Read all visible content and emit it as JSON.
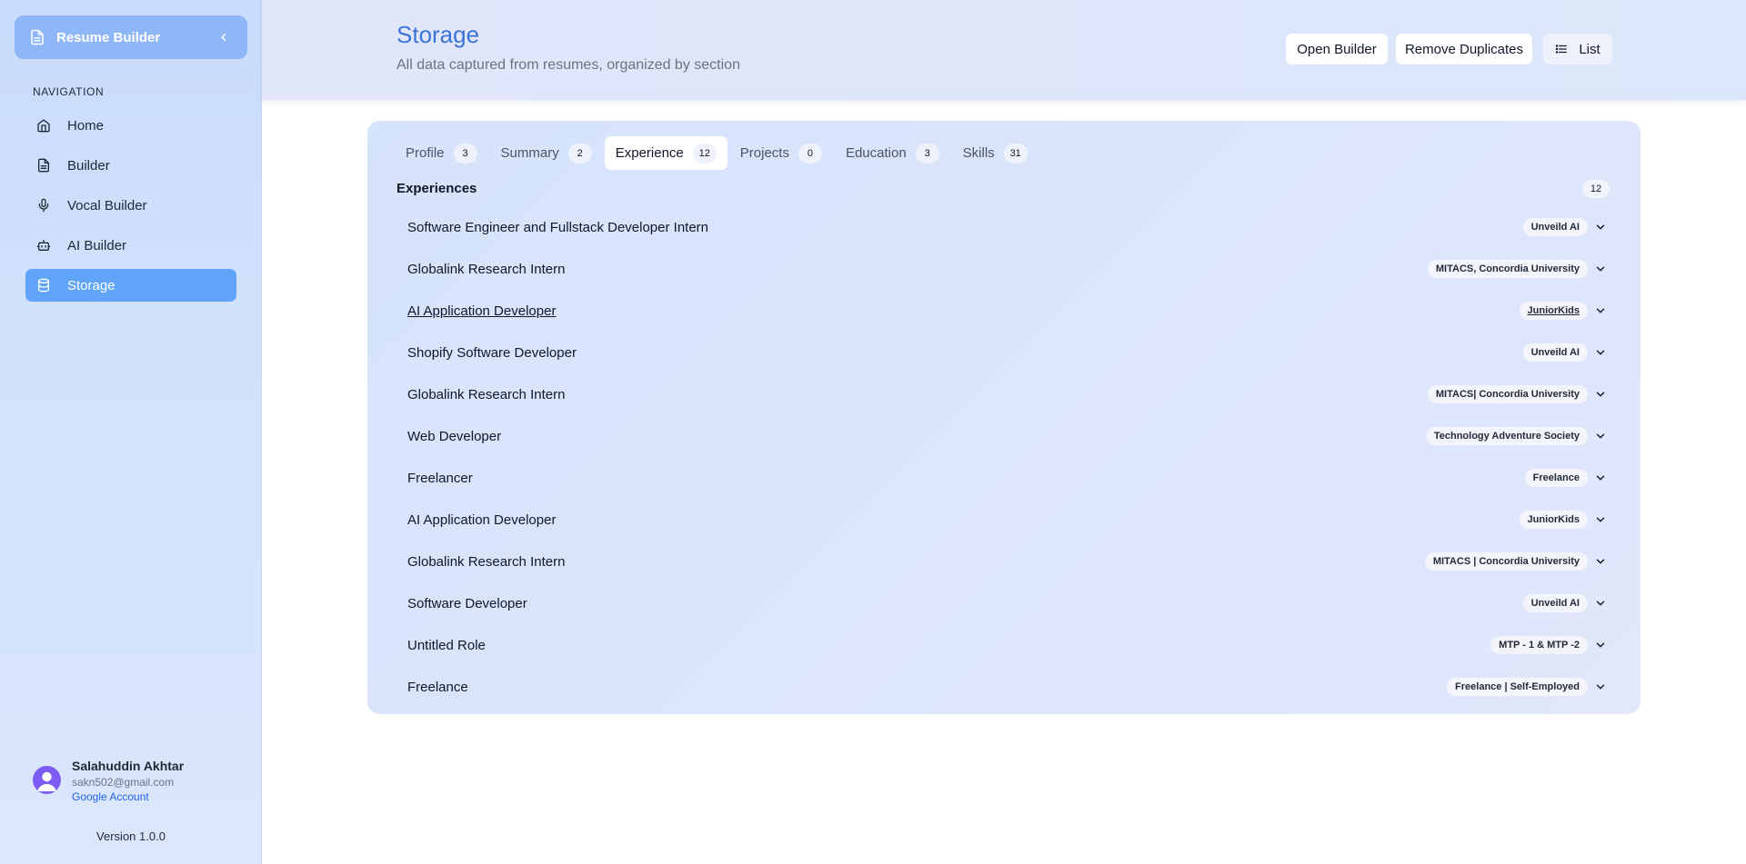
{
  "sidebar": {
    "brand": "Resume Builder",
    "nav_heading": "NAVIGATION",
    "items": [
      {
        "label": "Home",
        "icon": "home-icon"
      },
      {
        "label": "Builder",
        "icon": "document-icon"
      },
      {
        "label": "Vocal Builder",
        "icon": "microphone-icon"
      },
      {
        "label": "AI Builder",
        "icon": "robot-icon"
      },
      {
        "label": "Storage",
        "icon": "database-icon",
        "active": true
      }
    ],
    "user": {
      "name": "Salahuddin Akhtar",
      "email": "sakn502@gmail.com",
      "account_link": "Google Account"
    },
    "version": "Version 1.0.0"
  },
  "header": {
    "title": "Storage",
    "subtitle": "All data captured from resumes, organized by section",
    "buttons": {
      "open_builder": "Open Builder",
      "remove_duplicates": "Remove Duplicates",
      "view_mode": "List"
    }
  },
  "tabs": [
    {
      "label": "Profile",
      "count": "3"
    },
    {
      "label": "Summary",
      "count": "2"
    },
    {
      "label": "Experience",
      "count": "12",
      "active": true
    },
    {
      "label": "Projects",
      "count": "0"
    },
    {
      "label": "Education",
      "count": "3"
    },
    {
      "label": "Skills",
      "count": "31"
    }
  ],
  "section": {
    "title": "Experiences",
    "count": "12"
  },
  "experiences": [
    {
      "title": "Software Engineer and Fullstack Developer Intern",
      "org": "Unveild AI"
    },
    {
      "title": "Globalink Research Intern",
      "org": "MITACS, Concordia University"
    },
    {
      "title": "AI Application Developer",
      "org": "JuniorKids",
      "hovered": true
    },
    {
      "title": "Shopify Software Developer",
      "org": "Unveild AI"
    },
    {
      "title": "Globalink Research Intern",
      "org": "MITACS| Concordia University"
    },
    {
      "title": "Web Developer",
      "org": "Technology Adventure Society"
    },
    {
      "title": "Freelancer",
      "org": "Freelance"
    },
    {
      "title": "AI Application Developer",
      "org": "JuniorKids"
    },
    {
      "title": "Globalink Research Intern",
      "org": "MITACS | Concordia University"
    },
    {
      "title": "Software Developer",
      "org": "Unveild AI"
    },
    {
      "title": "Untitled Role",
      "org": "MTP - 1 & MTP -2"
    },
    {
      "title": "Freelance",
      "org": "Freelance | Self-Employed"
    }
  ],
  "colors": {
    "accent": "#3b74d6",
    "active_nav": "#60a5fa",
    "avatar": "#7c5cf2",
    "link": "#2563eb"
  }
}
